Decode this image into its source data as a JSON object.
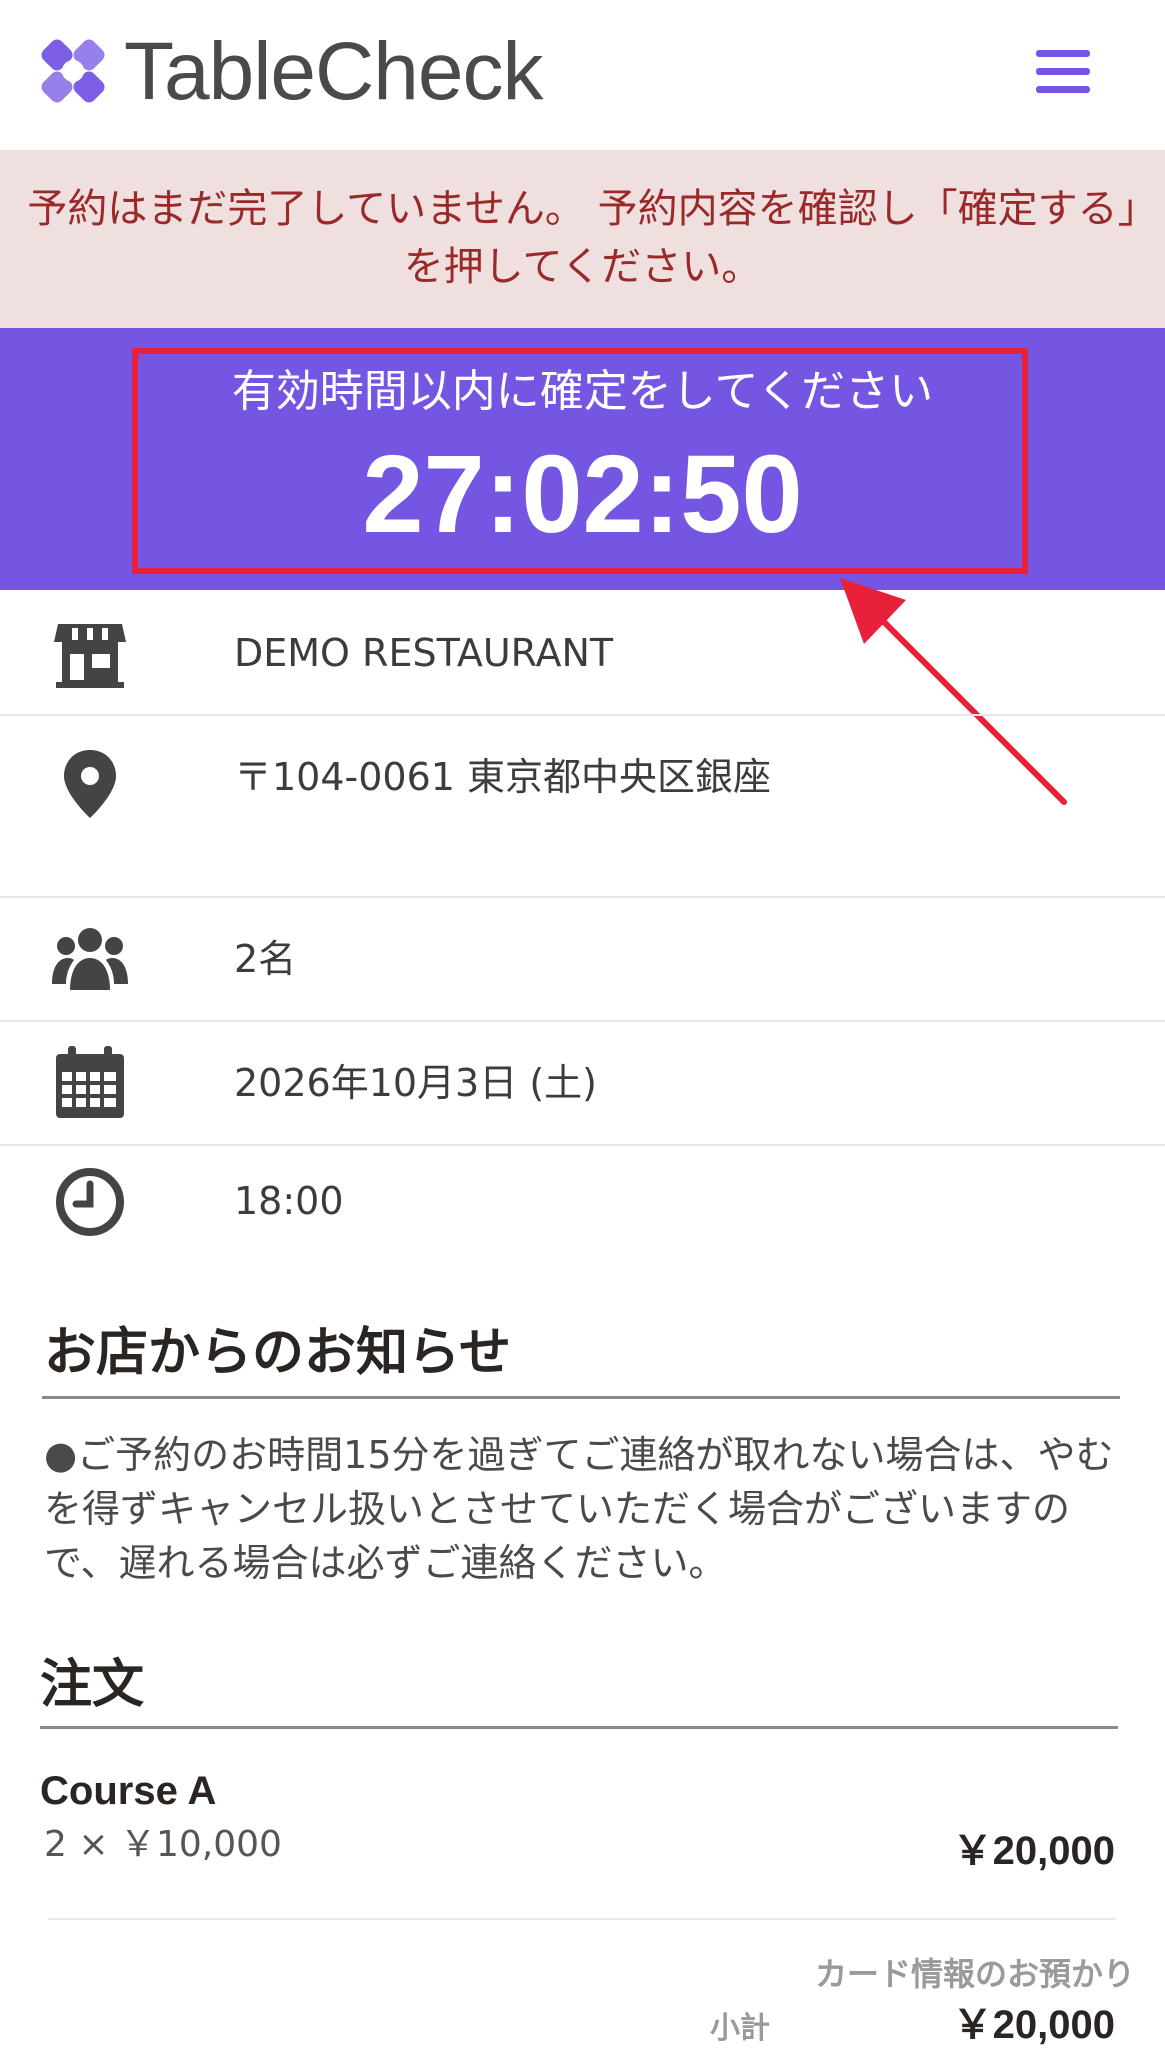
{
  "header": {
    "brand": "TableCheck",
    "brand_color": "#7556e3",
    "menu_icon": "hamburger-icon"
  },
  "alert": {
    "message": "予約はまだ完了していません。 予約内容を確認し「確定する」を押してください。"
  },
  "timer": {
    "label": "有効時間以内に確定をしてください",
    "value": "27:02:50"
  },
  "details": {
    "restaurant": "DEMO RESTAURANT",
    "address": "〒104-0061 東京都中央区銀座",
    "party_size": "2名",
    "date": "2026年10月3日 (土)",
    "time": "18:00"
  },
  "notice": {
    "title": "お店からのお知らせ",
    "body": "●ご予約のお時間15分を過ぎてご連絡が取れない場合は、やむを得ずキャンセル扱いとさせていただく場合がございますので、遅れる場合は必ずご連絡ください。"
  },
  "order": {
    "title": "注文",
    "items": [
      {
        "name": "Course A",
        "quantity_price": "2 × ￥10,000",
        "total": "￥20,000"
      }
    ],
    "card_note": "カード情報のお預かり",
    "subtotal_label": "小計",
    "subtotal_value": "￥20,000"
  }
}
